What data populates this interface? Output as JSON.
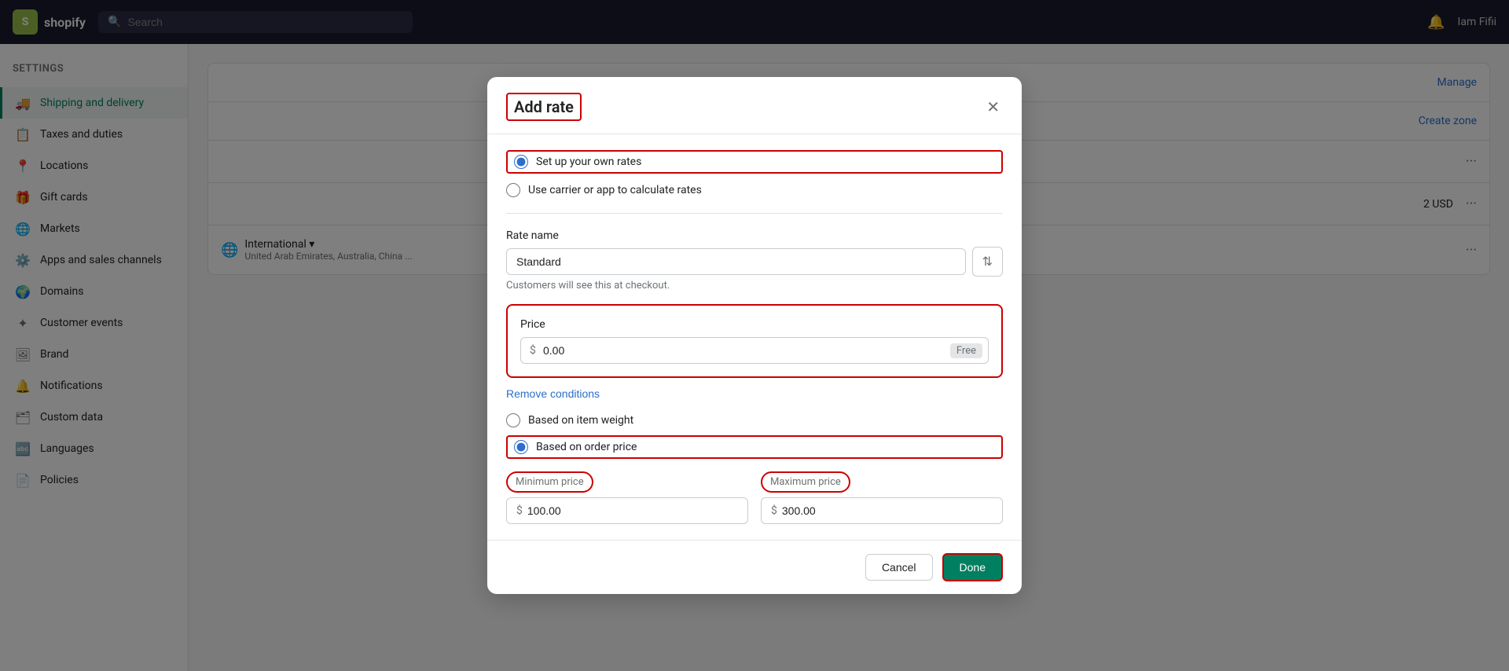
{
  "app": {
    "logo_text": "shopify",
    "settings_label": "Settings",
    "search_placeholder": "Search"
  },
  "nav_right": {
    "notifications_icon": "🔔",
    "user_label": "Iam Fifii"
  },
  "sidebar": {
    "items": [
      {
        "id": "shipping",
        "label": "Shipping and delivery",
        "icon": "🚚",
        "active": true
      },
      {
        "id": "taxes",
        "label": "Taxes and duties",
        "icon": "📋",
        "active": false
      },
      {
        "id": "locations",
        "label": "Locations",
        "icon": "📍",
        "active": false
      },
      {
        "id": "gift-cards",
        "label": "Gift cards",
        "icon": "🎁",
        "active": false
      },
      {
        "id": "markets",
        "label": "Markets",
        "icon": "🌐",
        "active": false
      },
      {
        "id": "apps",
        "label": "Apps and sales channels",
        "icon": "⚙️",
        "active": false
      },
      {
        "id": "domains",
        "label": "Domains",
        "icon": "🌍",
        "active": false
      },
      {
        "id": "customer-events",
        "label": "Customer events",
        "icon": "✦",
        "active": false
      },
      {
        "id": "brand",
        "label": "Brand",
        "icon": "🖼",
        "active": false
      },
      {
        "id": "notifications",
        "label": "Notifications",
        "icon": "🔔",
        "active": false
      },
      {
        "id": "custom-data",
        "label": "Custom data",
        "icon": "🗂",
        "active": false
      },
      {
        "id": "languages",
        "label": "Languages",
        "icon": "🔤",
        "active": false
      },
      {
        "id": "policies",
        "label": "Policies",
        "icon": "📄",
        "active": false
      }
    ]
  },
  "page": {
    "title": "Shipping and delivery",
    "manage_label": "Manage",
    "create_zone_label": "Create zone",
    "international_label": "International ▾",
    "international_subtitle": "United Arab Emirates, Australia, China ..."
  },
  "modal": {
    "title": "Add rate",
    "close_icon": "✕",
    "options": [
      {
        "id": "own-rates",
        "label": "Set up your own rates",
        "checked": true,
        "highlighted": true
      },
      {
        "id": "carrier-rates",
        "label": "Use carrier or app to calculate rates",
        "checked": false
      }
    ],
    "rate_name_label": "Rate name",
    "rate_name_value": "Standard",
    "rate_name_placeholder": "Standard",
    "customers_see_note": "Customers will see this at checkout.",
    "price_label": "Price",
    "price_value": "0.00",
    "price_prefix": "$",
    "price_badge": "Free",
    "remove_conditions_label": "Remove conditions",
    "condition_options": [
      {
        "id": "item-weight",
        "label": "Based on item weight",
        "checked": false
      },
      {
        "id": "order-price",
        "label": "Based on order price",
        "checked": true,
        "highlighted": true
      }
    ],
    "min_price_label": "Minimum price",
    "max_price_label": "Maximum price",
    "min_price_value": "100.00",
    "max_price_value": "300.00",
    "cancel_label": "Cancel",
    "done_label": "Done"
  },
  "background_rows": [
    {
      "label": "Manage",
      "dots": "···"
    },
    {
      "label": "Create zone",
      "dots": "···"
    },
    {
      "label": "···",
      "amount": "2 USD"
    }
  ]
}
